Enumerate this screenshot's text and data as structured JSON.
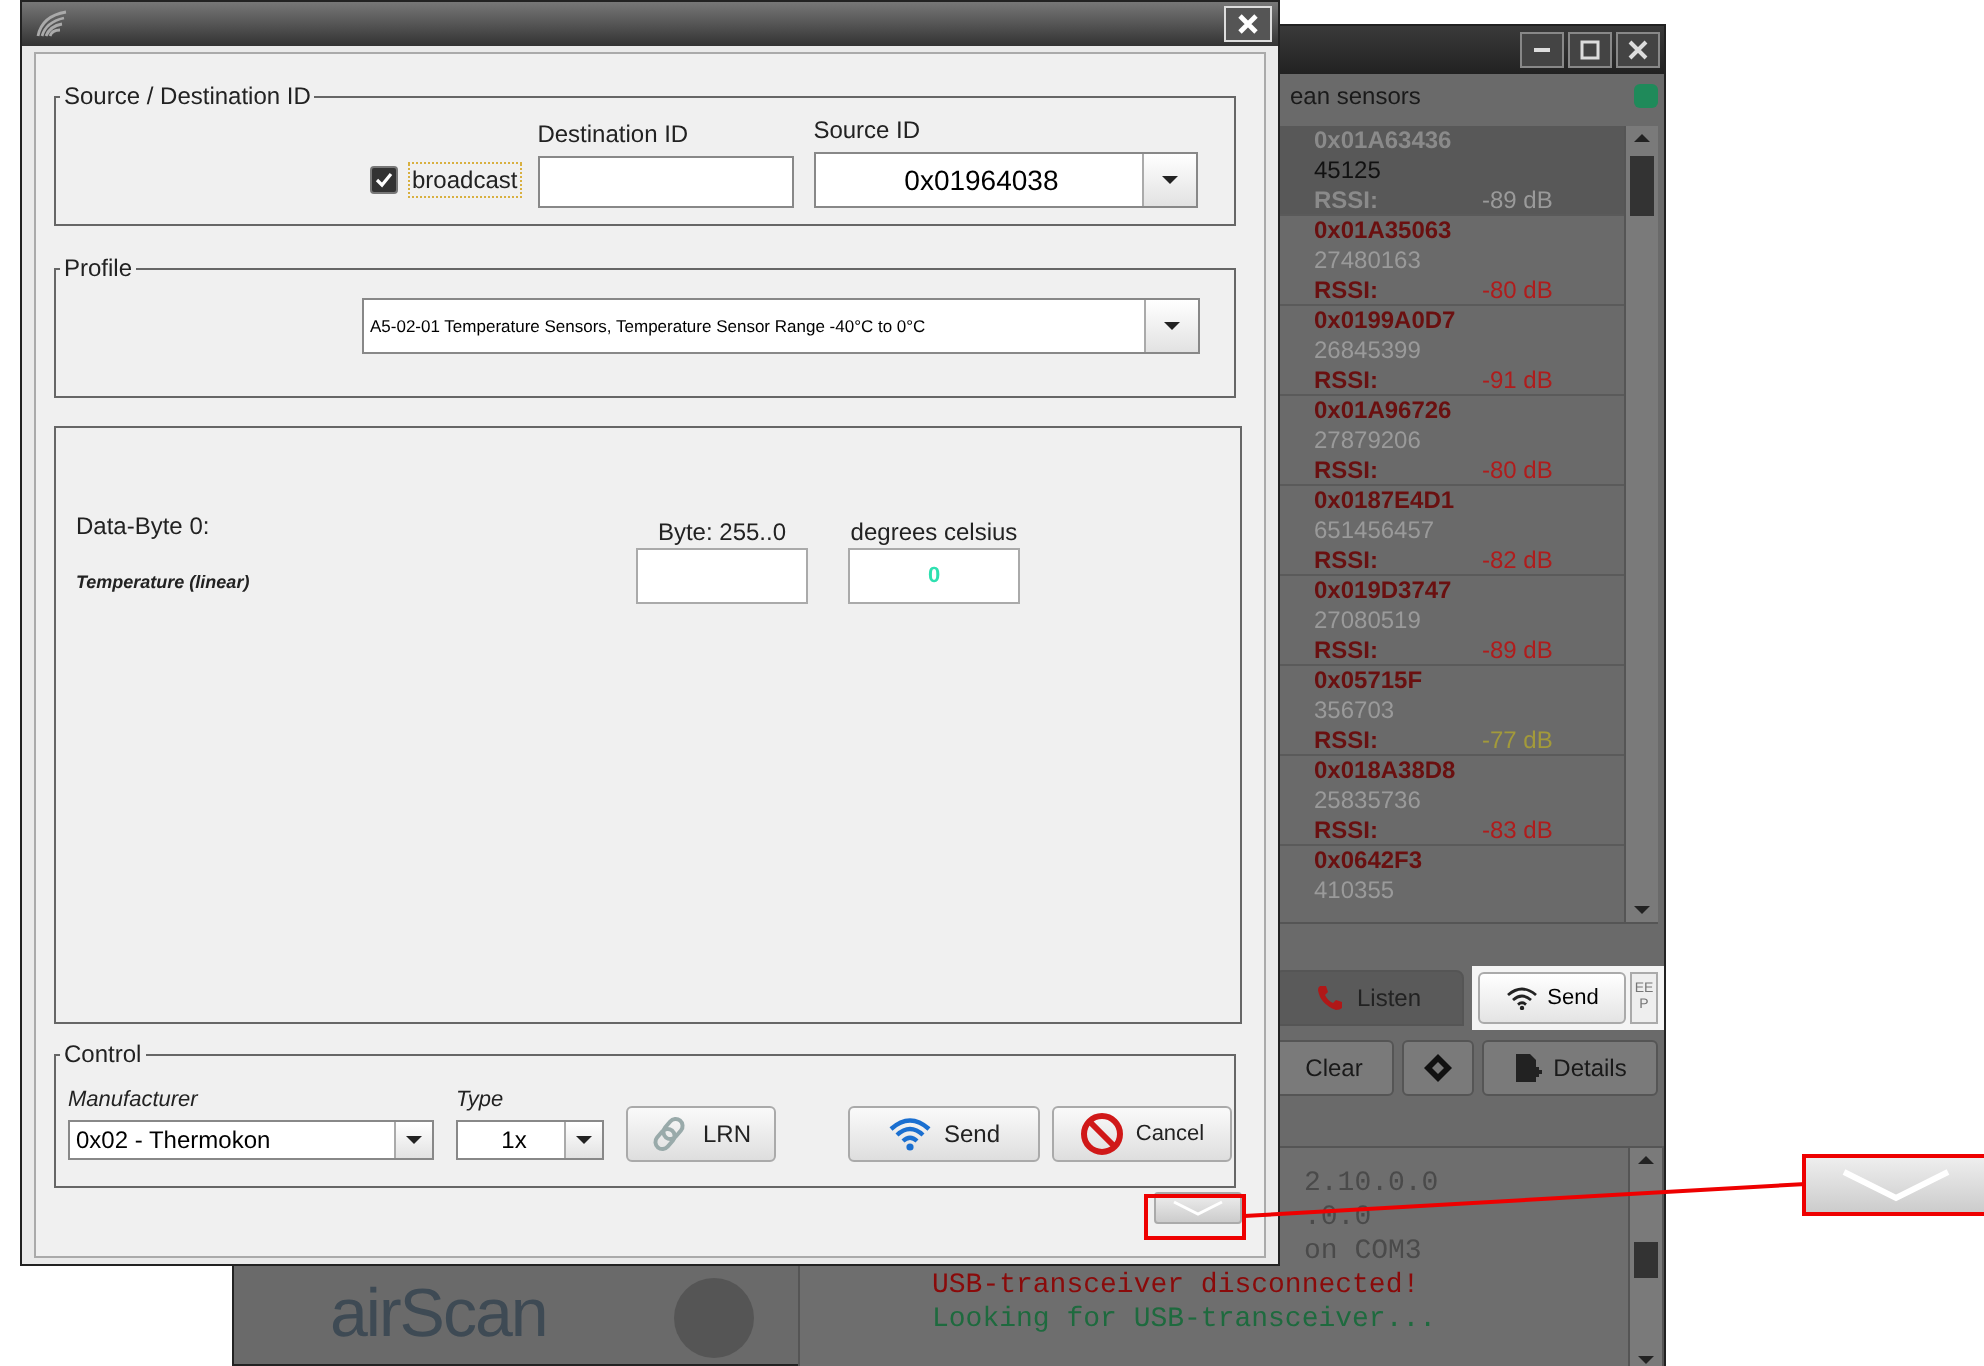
{
  "dialog": {
    "source_destination": {
      "legend": "Source / Destination ID",
      "broadcast": {
        "label": "broadcast",
        "checked": true
      },
      "destination": {
        "label": "Destination ID"
      },
      "source": {
        "label": "Source ID",
        "value": "0x01964038"
      }
    },
    "profile": {
      "legend": "Profile",
      "value": "A5-02-01 Temperature Sensors, Temperature Sensor Range -40°C to 0°C"
    },
    "data": {
      "heading": "Data-Byte 0:",
      "field": "Temperature (linear)",
      "raw": {
        "label": "Byte: 255..0"
      },
      "scaled": {
        "label": "degrees celsius",
        "value": "0"
      }
    },
    "control": {
      "legend": "Control",
      "manufacturer": {
        "label": "Manufacturer",
        "value": "0x02 - Thermokon"
      },
      "type": {
        "label": "Type",
        "value": "1x"
      },
      "buttons": [
        {
          "kind": "lrn",
          "label": "LRN"
        },
        {
          "kind": "send",
          "label": "Send"
        },
        {
          "kind": "cancel",
          "label": "Cancel"
        }
      ]
    }
  },
  "main_window": {
    "header": "ean sensors",
    "sensors": [
      {
        "id": "0x01A63436",
        "number": "45125",
        "rssi_label": "RSSI:",
        "rssi": "-89 dB",
        "color": "#9a9a9a",
        "selected": true
      },
      {
        "id": "0x01A35063",
        "number": "27480163",
        "rssi_label": "RSSI:",
        "rssi": "-80 dB",
        "color": "#b01c1c",
        "selected": false
      },
      {
        "id": "0x0199A0D7",
        "number": "26845399",
        "rssi_label": "RSSI:",
        "rssi": "-91 dB",
        "color": "#b01c1c",
        "selected": false
      },
      {
        "id": "0x01A96726",
        "number": "27879206",
        "rssi_label": "RSSI:",
        "rssi": "-80 dB",
        "color": "#b01c1c",
        "selected": false
      },
      {
        "id": "0x0187E4D1",
        "number": "651456457",
        "rssi_label": "RSSI:",
        "rssi": "-82 dB",
        "color": "#b01c1c",
        "selected": false
      },
      {
        "id": "0x019D3747",
        "number": "27080519",
        "rssi_label": "RSSI:",
        "rssi": "-89 dB",
        "color": "#b01c1c",
        "selected": false
      },
      {
        "id": "0x05715F",
        "number": "356703",
        "rssi_label": "RSSI:",
        "rssi": "-77 dB",
        "color": "#a39a3a",
        "selected": false
      },
      {
        "id": "0x018A38D8",
        "number": "25835736",
        "rssi_label": "RSSI:",
        "rssi": "-83 dB",
        "color": "#b01c1c",
        "selected": false
      },
      {
        "id": "0x0642F3",
        "number": "410355",
        "selected": false
      }
    ],
    "listen": "Listen",
    "send": "Send",
    "eep": "EEP",
    "clear": "Clear",
    "details": "Details",
    "console": [
      {
        "kind": "fragment",
        "text": "2.10.0.0",
        "color": "#4a4a4a"
      },
      {
        "kind": "fragment",
        "text": ".0.0",
        "color": "#4a4a4a"
      },
      {
        "kind": "fragment",
        "text": "on COM3",
        "color": "#4a4a4a"
      },
      {
        "kind": "line",
        "text": "USB-transceiver disconnected!",
        "color": "#8a0a0a"
      },
      {
        "kind": "line",
        "text": "Looking for USB-transceiver...",
        "color": "#1e6a3e"
      }
    ],
    "logo": "airScan"
  }
}
